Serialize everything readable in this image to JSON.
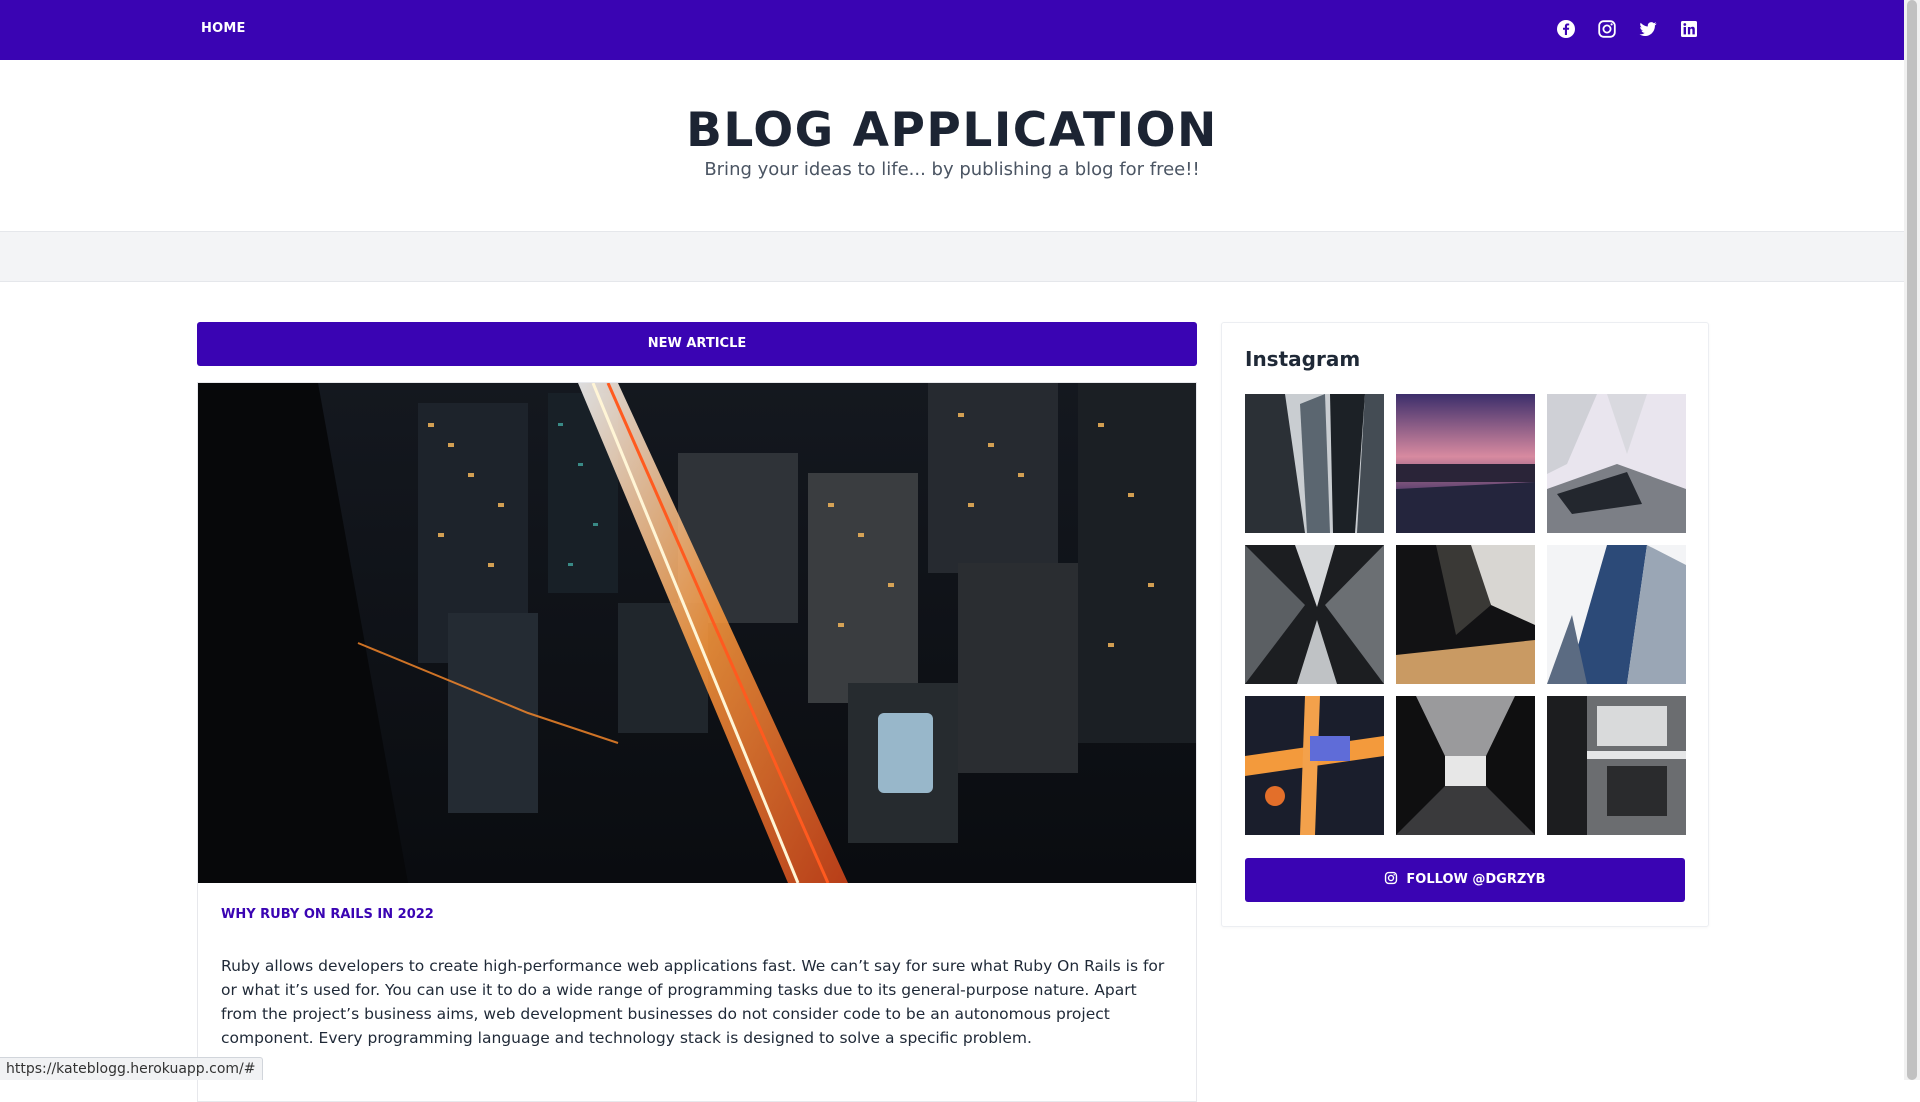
{
  "nav": {
    "home_label": "HOME",
    "social_icons": [
      "facebook-icon",
      "instagram-icon",
      "twitter-icon",
      "linkedin-icon"
    ]
  },
  "header": {
    "title": "BLOG APPLICATION",
    "tagline": "Bring your ideas to life... by publishing a blog for free!!"
  },
  "main": {
    "new_article_label": "NEW ARTICLE",
    "article": {
      "category_link": "WHY RUBY ON RAILS IN 2022",
      "body": "Ruby allows developers to create high-performance web applications fast. We can’t say for sure what Ruby On Rails is for or what it’s used for. You can use it to do a wide range of programming tasks due to its general-purpose nature. Apart from the project’s business aims, web development businesses do not consider code to be an autonomous project component. Every programming language and technology stack is designed to solve a specific problem."
    }
  },
  "sidebar": {
    "instagram_title": "Instagram",
    "follow_label": "FOLLOW @DGRZYB"
  },
  "status_bar": {
    "url": "https://kateblogg.herokuapp.com/#"
  },
  "colors": {
    "brand": "#3a04b3",
    "title_text": "#1c2433",
    "band": "#f3f4f6"
  }
}
